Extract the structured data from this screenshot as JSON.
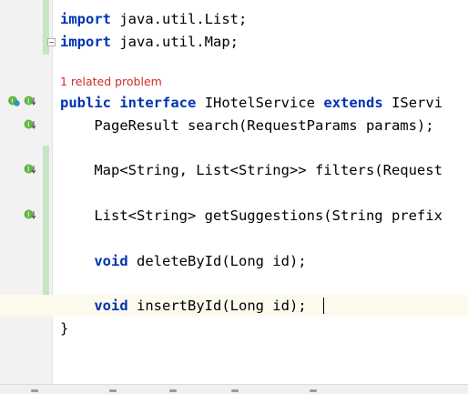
{
  "editor": {
    "language": "Java",
    "colors": {
      "keyword": "#0033b3",
      "text": "#000000",
      "error_hint": "#d32b2b",
      "gutter_background": "#f2f2f2",
      "current_line_background": "#fcfaed",
      "change_marker": "#c9e4c4"
    },
    "problem_hint": "1 related problem",
    "lines": [
      {
        "kw": "import",
        "rest": "java.util.List;"
      },
      {
        "kw": "import",
        "rest": "java.util.Map;"
      },
      {
        "kw1": "public",
        "kw2": "interface",
        "name": "IHotelService",
        "kw3": "extends",
        "rest": "IServi"
      },
      {
        "indent": "    ",
        "rest": "PageResult search(RequestParams params);"
      },
      {
        "indent": "    ",
        "rest": "Map<String, List<String>> filters(Request"
      },
      {
        "indent": "    ",
        "rest": "List<String> getSuggestions(String prefix"
      },
      {
        "indent": "    ",
        "kw": "void",
        "rest": "deleteById(Long id);"
      },
      {
        "indent": "    ",
        "kw": "void",
        "rest": "insertById(Long id);"
      },
      {
        "rest": "}"
      }
    ],
    "gutter_icons": [
      "implemented-interface-icon",
      "implemented-method-icon",
      "implemented-method-icon",
      "implemented-method-icon",
      "implemented-method-icon"
    ]
  }
}
